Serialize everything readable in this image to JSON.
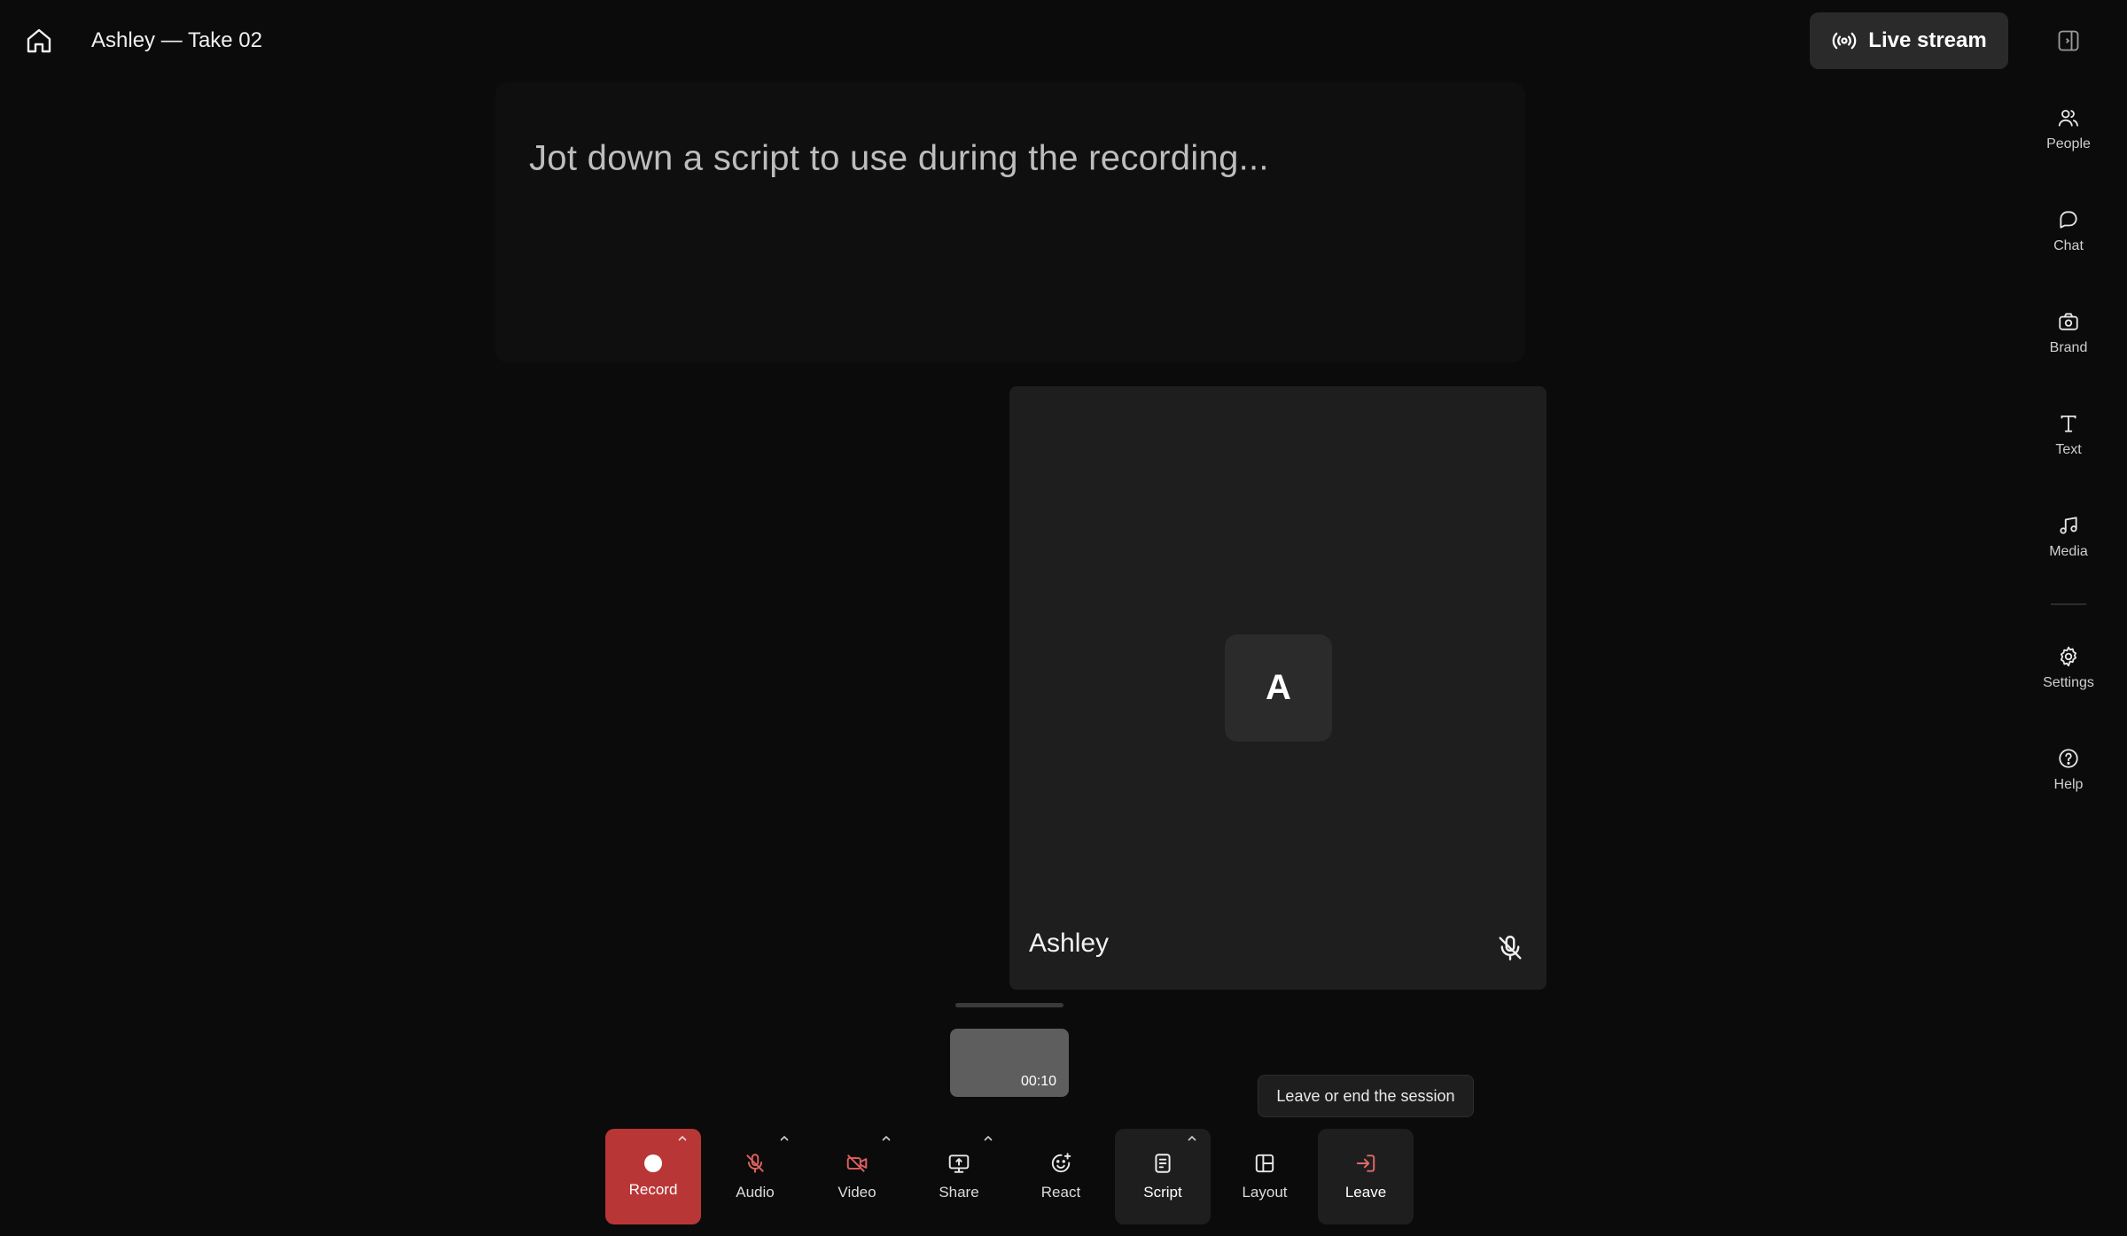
{
  "header": {
    "title": "Ashley — Take 02",
    "live_stream_label": "Live stream"
  },
  "sidebar": {
    "items": [
      {
        "label": "People",
        "icon": "people-icon"
      },
      {
        "label": "Chat",
        "icon": "chat-icon"
      },
      {
        "label": "Brand",
        "icon": "brand-icon"
      },
      {
        "label": "Text",
        "icon": "text-icon"
      },
      {
        "label": "Media",
        "icon": "music-note-icon"
      },
      {
        "label": "Settings",
        "icon": "gear-icon"
      },
      {
        "label": "Help",
        "icon": "help-icon"
      }
    ]
  },
  "script": {
    "placeholder": "Jot down a script to use during the recording..."
  },
  "participant": {
    "initial": "A",
    "name": "Ashley",
    "mic_muted": true
  },
  "timeline": {
    "thumbnail_time": "00:10"
  },
  "tooltip": {
    "text": "Leave or end the session"
  },
  "toolbar": {
    "record": "Record",
    "audio": "Audio",
    "video": "Video",
    "share": "Share",
    "react": "React",
    "script": "Script",
    "layout": "Layout",
    "leave": "Leave"
  },
  "colors": {
    "background": "#0b0b0b",
    "record": "#b93636",
    "muted_icon": "#e06060",
    "leave_icon": "#e06a6a",
    "tile": "#1e1e1e"
  }
}
